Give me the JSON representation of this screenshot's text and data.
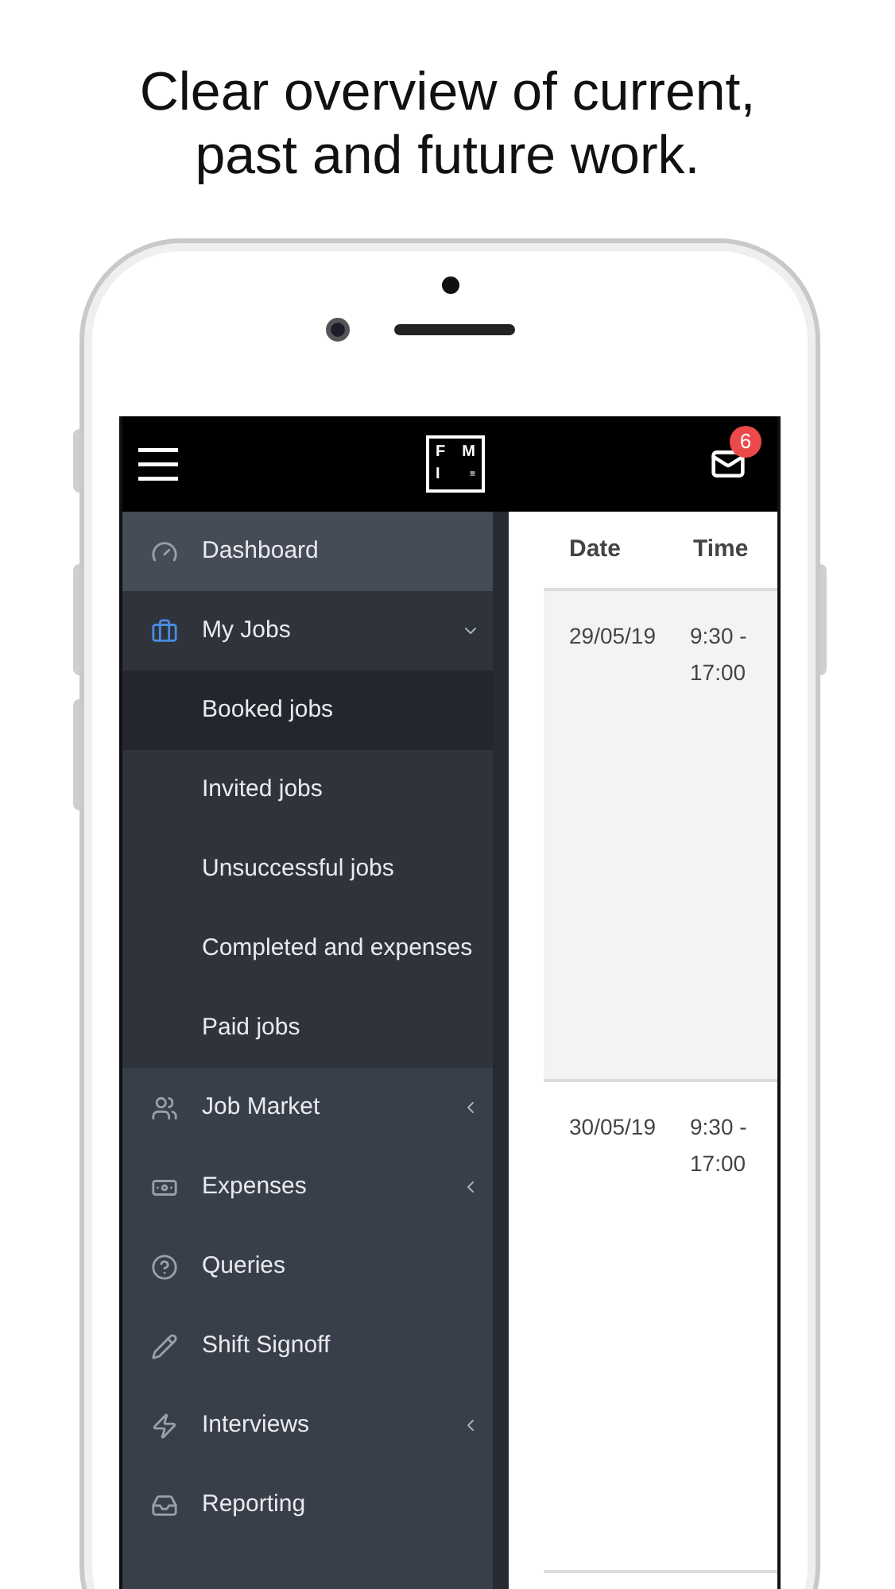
{
  "headline": "Clear overview of current, past and future work.",
  "header": {
    "logo_letters": [
      "F",
      "M",
      "I",
      "≡"
    ],
    "message_count": "6"
  },
  "menu": [
    {
      "label": "Dashboard",
      "kind": "link",
      "selected": true
    },
    {
      "label": "My Jobs",
      "kind": "group",
      "expanded": true,
      "selected": false,
      "children": [
        {
          "label": "Booked jobs",
          "selected": true
        },
        {
          "label": "Invited jobs",
          "selected": false
        },
        {
          "label": "Unsuccessful jobs",
          "selected": false
        },
        {
          "label": "Completed and expenses",
          "selected": false
        },
        {
          "label": "Paid jobs",
          "selected": false
        }
      ]
    },
    {
      "label": "Job Market",
      "kind": "group",
      "expanded": false,
      "selected": false
    },
    {
      "label": "Expenses",
      "kind": "group",
      "expanded": false,
      "selected": false
    },
    {
      "label": "Queries",
      "kind": "link",
      "selected": false
    },
    {
      "label": "Shift Signoff",
      "kind": "link",
      "selected": false
    },
    {
      "label": "Interviews",
      "kind": "group",
      "expanded": false,
      "selected": false
    },
    {
      "label": "Reporting",
      "kind": "link",
      "selected": false
    }
  ],
  "table": {
    "columns": [
      "Date",
      "Time"
    ],
    "rows": [
      {
        "date": "29/05/19",
        "time": "9:30 - 17:00"
      },
      {
        "date": "30/05/19",
        "time": "9:30 - 17:00"
      }
    ]
  }
}
